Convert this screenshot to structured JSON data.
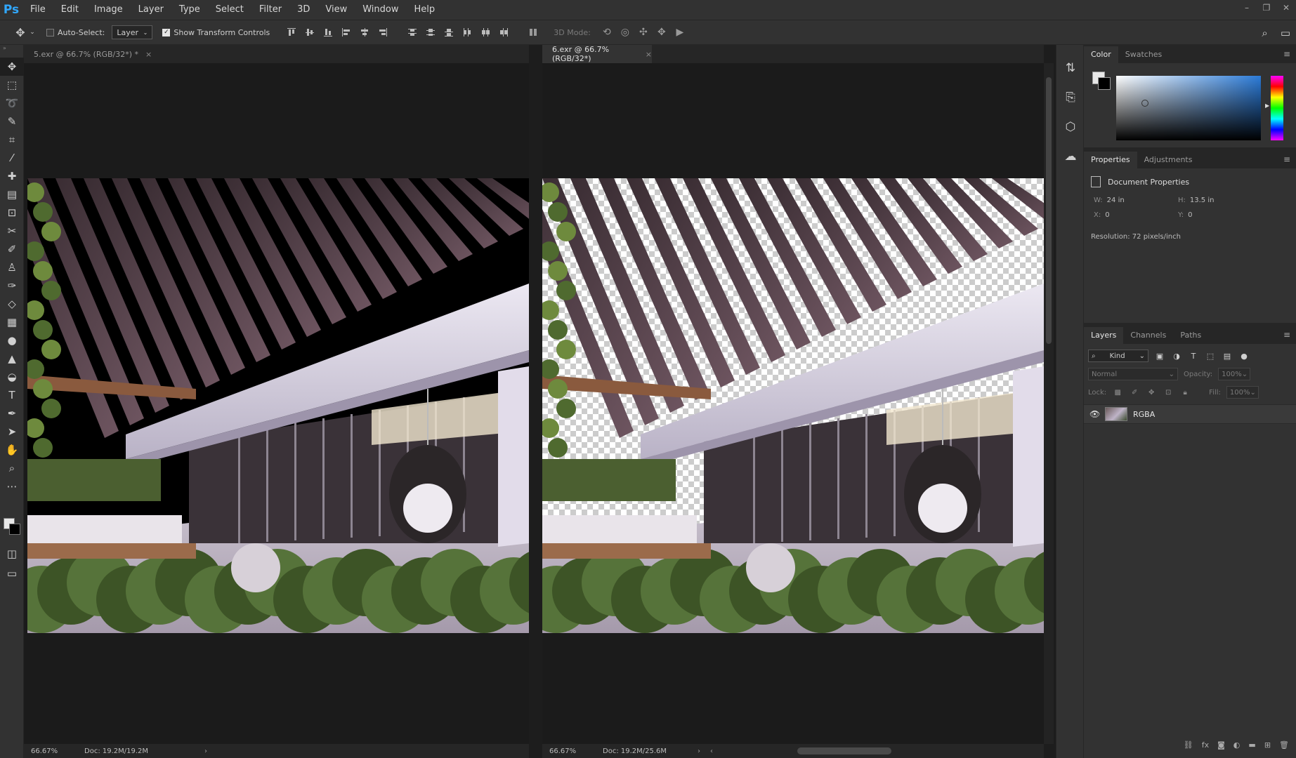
{
  "app": {
    "logo": "Ps",
    "menu": [
      "File",
      "Edit",
      "Image",
      "Layer",
      "Type",
      "Select",
      "Filter",
      "3D",
      "View",
      "Window",
      "Help"
    ],
    "window_controls": [
      "–",
      "❐",
      "✕"
    ]
  },
  "options_bar": {
    "auto_select_label": "Auto-Select:",
    "auto_select_checked": false,
    "auto_select_target": "Layer",
    "show_transform_label": "Show Transform Controls",
    "show_transform_checked": true,
    "mode_3d_label": "3D Mode:"
  },
  "documents": [
    {
      "tab_title": "5.exr @ 66.7% (RGB/32*) *",
      "active": false,
      "zoom": "66.67%",
      "doc_info": "Doc: 19.2M/19.2M",
      "transparent_sky": false
    },
    {
      "tab_title": "6.exr @ 66.7% (RGB/32*)",
      "active": true,
      "zoom": "66.67%",
      "doc_info": "Doc: 19.2M/25.6M",
      "transparent_sky": true
    }
  ],
  "color_panel": {
    "tabs": [
      "Color",
      "Swatches"
    ],
    "foreground": "#e8e8e8",
    "background": "#000000",
    "hue": "#2b7bd8"
  },
  "properties_panel": {
    "tabs": [
      "Properties",
      "Adjustments"
    ],
    "heading": "Document Properties",
    "width_label": "W:",
    "width": "24 in",
    "height_label": "H:",
    "height": "13.5 in",
    "x_label": "X:",
    "x": "0",
    "y_label": "Y:",
    "y": "0",
    "resolution": "Resolution: 72 pixels/inch"
  },
  "layers_panel": {
    "tabs": [
      "Layers",
      "Channels",
      "Paths"
    ],
    "kind_filter": "Kind",
    "blend_mode": "Normal",
    "opacity_label": "Opacity:",
    "opacity": "100%",
    "lock_label": "Lock:",
    "fill_label": "Fill:",
    "fill": "100%",
    "layers": [
      {
        "name": "RGBA",
        "visible": true
      }
    ]
  }
}
